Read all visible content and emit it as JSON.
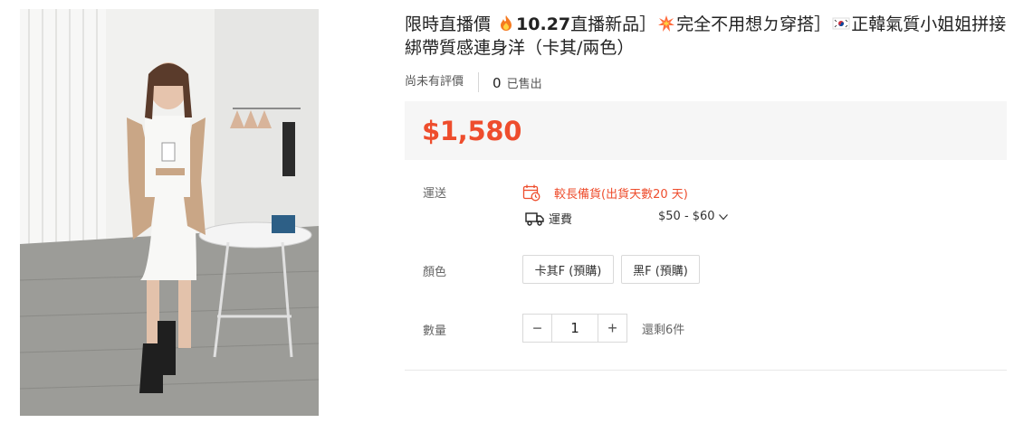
{
  "product": {
    "title_prefix": "限時直播價 ",
    "title_bold": "10.27",
    "title_part2": "直播新品］",
    "title_part3": "完全不用想ㄉ穿搭］",
    "title_part4": "正韓氣質小姐姐拼接綁帶質感連身洋（卡其/兩色）",
    "image_alt": "product photo"
  },
  "ratings": {
    "no_rating_text": "尚未有評價",
    "sold_count": "0",
    "sold_label": "已售出"
  },
  "price": {
    "value": "$1,580",
    "color": "#ee4d2d"
  },
  "shipping": {
    "label": "運送",
    "preorder_notice": "較長備貨(出貨天數20 天)",
    "fee_label": "運費",
    "fee_range": "$50 - $60"
  },
  "variation": {
    "label": "顏色",
    "options": [
      "卡其F (預購)",
      "黑F (預購)"
    ]
  },
  "quantity": {
    "label": "數量",
    "decrease": "−",
    "value": "1",
    "increase": "+",
    "stock_text": "還剩6件"
  },
  "icons": {
    "fire": "fire-icon",
    "explosion": "collision-icon",
    "flag": "korea-flag-icon",
    "calendar": "calendar-clock-icon",
    "truck": "truck-icon",
    "chevron": "chevron-down-icon"
  }
}
